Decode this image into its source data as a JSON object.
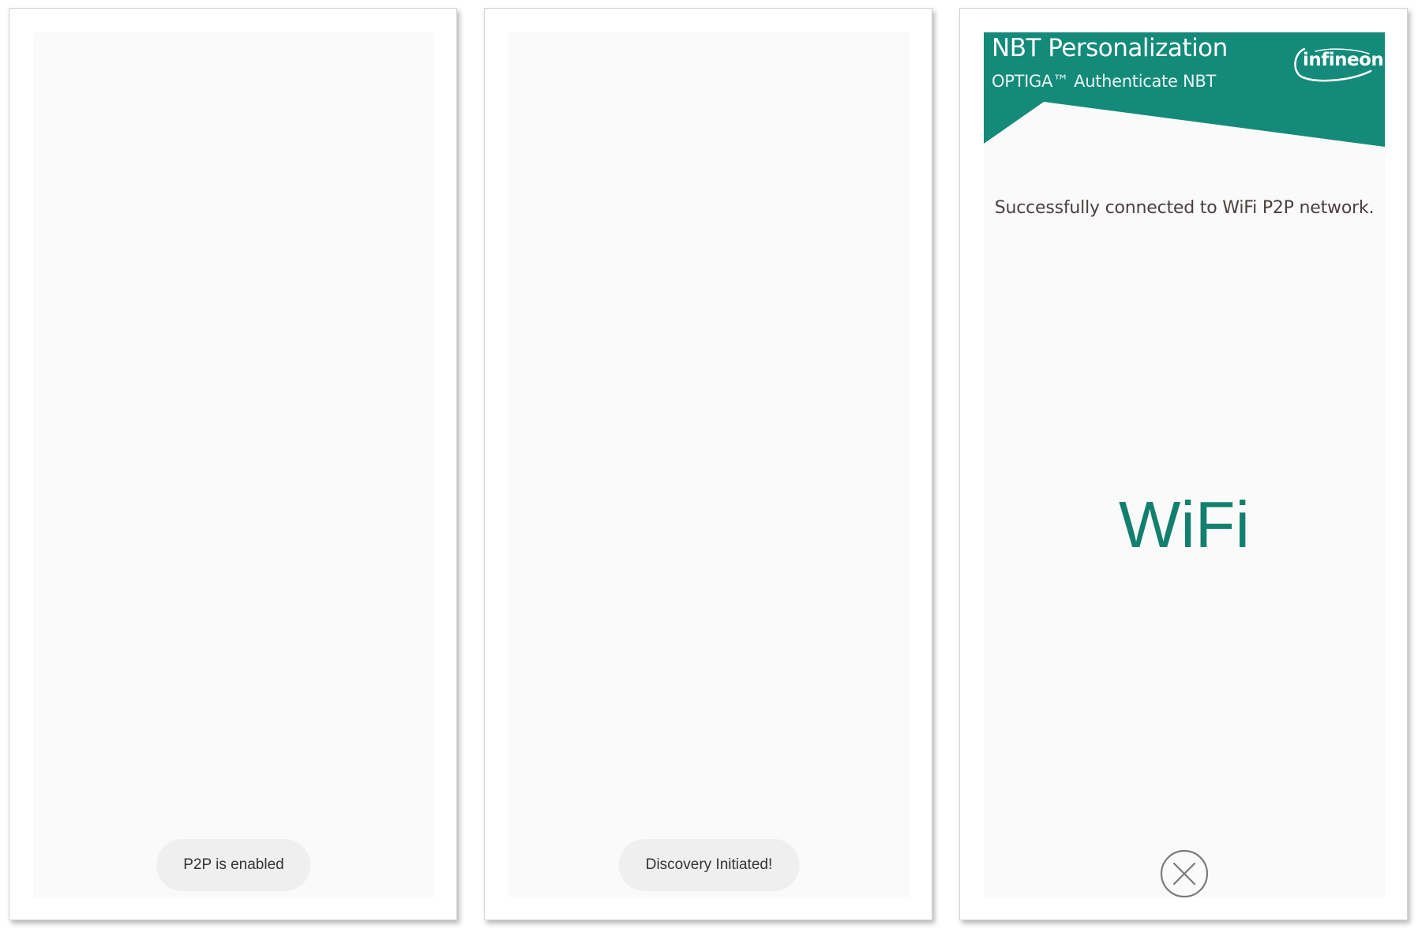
{
  "screens": [
    {
      "toast": {
        "text": "P2P is enabled"
      }
    },
    {
      "toast": {
        "text": "Discovery Initiated!"
      }
    },
    {
      "header": {
        "title": "NBT Personalization",
        "subtitle": "OPTIGA™ Authenticate NBT",
        "logo_text": "infineon"
      },
      "status_message": "Successfully connected to WiFi P2P network.",
      "connection_label": "WiFi",
      "close_icon": "close-circle-icon"
    }
  ],
  "colors": {
    "brand_teal": "#148A7A",
    "wifi_label": "#13806F",
    "toast_bg": "#EFEFEF",
    "screen_bg": "#FAFAFA"
  }
}
